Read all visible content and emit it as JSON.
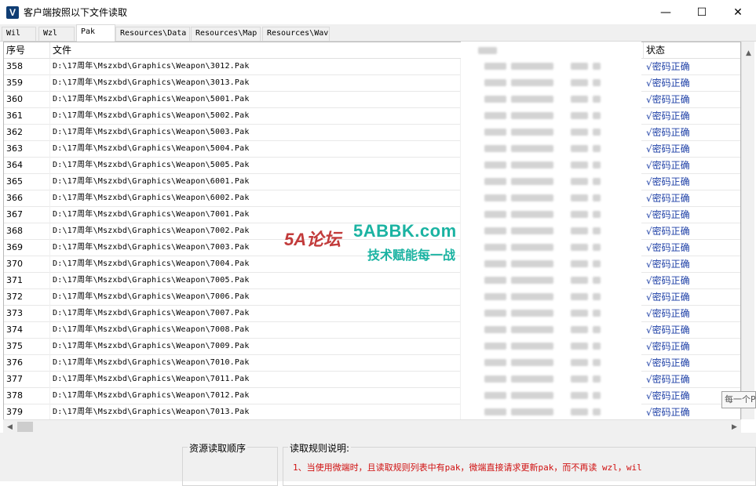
{
  "window": {
    "title": "客户端按照以下文件读取",
    "icon_letter": "V",
    "minimize_glyph": "—",
    "maximize_glyph": "☐",
    "close_glyph": "✕"
  },
  "tabs": [
    {
      "label": "Wil",
      "active": false
    },
    {
      "label": "Wzl",
      "active": false
    },
    {
      "label": "Pak",
      "active": true
    },
    {
      "label": "Resources\\Data",
      "active": false
    },
    {
      "label": "Resources\\Map",
      "active": false
    },
    {
      "label": "Resources\\Wav",
      "active": false
    }
  ],
  "table": {
    "headers": {
      "index": "序号",
      "file": "文件",
      "status": "状态"
    },
    "rows": [
      {
        "index": "358",
        "file": "D:\\17周年\\Mszxbd\\Graphics\\Weapon\\3012.Pak",
        "status": "√密码正确"
      },
      {
        "index": "359",
        "file": "D:\\17周年\\Mszxbd\\Graphics\\Weapon\\3013.Pak",
        "status": "√密码正确"
      },
      {
        "index": "360",
        "file": "D:\\17周年\\Mszxbd\\Graphics\\Weapon\\5001.Pak",
        "status": "√密码正确"
      },
      {
        "index": "361",
        "file": "D:\\17周年\\Mszxbd\\Graphics\\Weapon\\5002.Pak",
        "status": "√密码正确"
      },
      {
        "index": "362",
        "file": "D:\\17周年\\Mszxbd\\Graphics\\Weapon\\5003.Pak",
        "status": "√密码正确"
      },
      {
        "index": "363",
        "file": "D:\\17周年\\Mszxbd\\Graphics\\Weapon\\5004.Pak",
        "status": "√密码正确"
      },
      {
        "index": "364",
        "file": "D:\\17周年\\Mszxbd\\Graphics\\Weapon\\5005.Pak",
        "status": "√密码正确"
      },
      {
        "index": "365",
        "file": "D:\\17周年\\Mszxbd\\Graphics\\Weapon\\6001.Pak",
        "status": "√密码正确"
      },
      {
        "index": "366",
        "file": "D:\\17周年\\Mszxbd\\Graphics\\Weapon\\6002.Pak",
        "status": "√密码正确"
      },
      {
        "index": "367",
        "file": "D:\\17周年\\Mszxbd\\Graphics\\Weapon\\7001.Pak",
        "status": "√密码正确"
      },
      {
        "index": "368",
        "file": "D:\\17周年\\Mszxbd\\Graphics\\Weapon\\7002.Pak",
        "status": "√密码正确"
      },
      {
        "index": "369",
        "file": "D:\\17周年\\Mszxbd\\Graphics\\Weapon\\7003.Pak",
        "status": "√密码正确"
      },
      {
        "index": "370",
        "file": "D:\\17周年\\Mszxbd\\Graphics\\Weapon\\7004.Pak",
        "status": "√密码正确"
      },
      {
        "index": "371",
        "file": "D:\\17周年\\Mszxbd\\Graphics\\Weapon\\7005.Pak",
        "status": "√密码正确"
      },
      {
        "index": "372",
        "file": "D:\\17周年\\Mszxbd\\Graphics\\Weapon\\7006.Pak",
        "status": "√密码正确"
      },
      {
        "index": "373",
        "file": "D:\\17周年\\Mszxbd\\Graphics\\Weapon\\7007.Pak",
        "status": "√密码正确"
      },
      {
        "index": "374",
        "file": "D:\\17周年\\Mszxbd\\Graphics\\Weapon\\7008.Pak",
        "status": "√密码正确"
      },
      {
        "index": "375",
        "file": "D:\\17周年\\Mszxbd\\Graphics\\Weapon\\7009.Pak",
        "status": "√密码正确"
      },
      {
        "index": "376",
        "file": "D:\\17周年\\Mszxbd\\Graphics\\Weapon\\7010.Pak",
        "status": "√密码正确"
      },
      {
        "index": "377",
        "file": "D:\\17周年\\Mszxbd\\Graphics\\Weapon\\7011.Pak",
        "status": "√密码正确"
      },
      {
        "index": "378",
        "file": "D:\\17周年\\Mszxbd\\Graphics\\Weapon\\7012.Pak",
        "status": "√密码正确"
      },
      {
        "index": "379",
        "file": "D:\\17周年\\Mszxbd\\Graphics\\Weapon\\7013.Pak",
        "status": "√密码正确"
      }
    ]
  },
  "tooltip_text": "每一个P",
  "bottom": {
    "read_order_title": "资源读取顺序",
    "rules_title": "读取规则说明:",
    "rule_1": "1、当使用微端时，且读取规则列表中有pak，微端直接请求更新pak，而不再读 wzl，wil"
  },
  "watermark": {
    "logo": "5A论坛",
    "site": "5ABBK.com",
    "slogan": "技术赋能每一战"
  },
  "colors": {
    "status_text": "#1d3fa6",
    "rule_text": "#d01010",
    "watermark": "#1bb3a2"
  }
}
